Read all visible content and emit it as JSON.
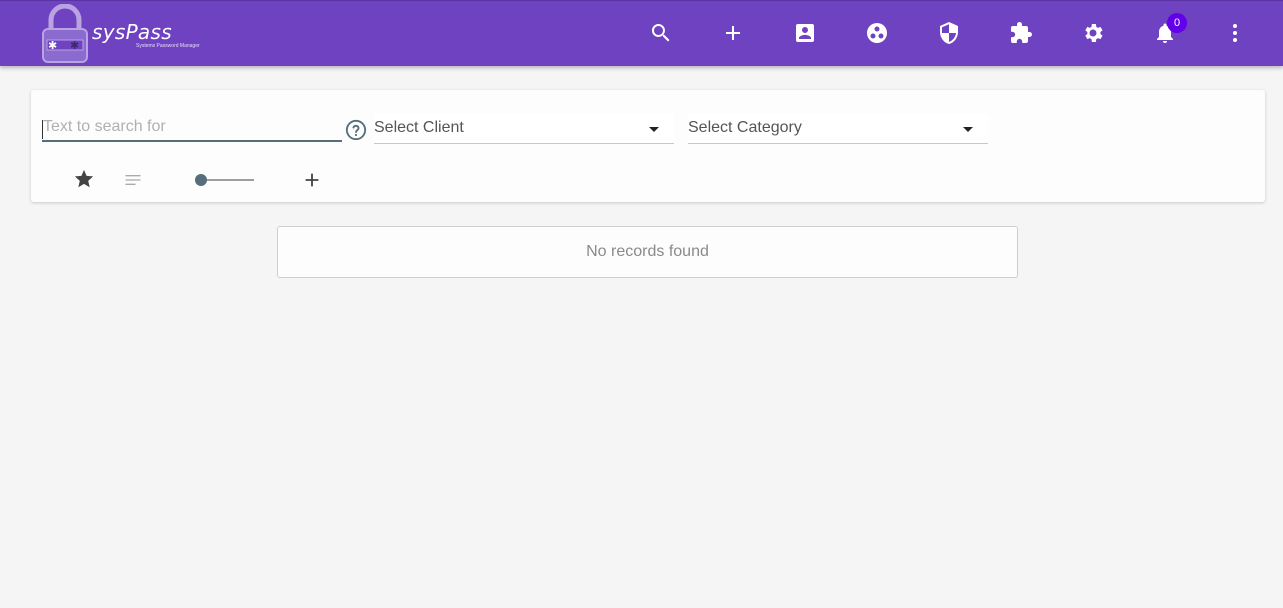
{
  "header": {
    "app_name": "sysPass",
    "app_subtitle": "Systems Password Manager",
    "nav_icons": [
      "search-icon",
      "add-icon",
      "account-box-icon",
      "group-icon",
      "security-shield-icon",
      "plugin-icon",
      "settings-icon",
      "notifications-icon",
      "more-vert-icon"
    ],
    "notifications_count": "0"
  },
  "search": {
    "placeholder": "Text to search for",
    "client_select": "Select Client",
    "category_select": "Select Category"
  },
  "tools": {
    "icons": [
      "favorite-star-icon",
      "sort-icon",
      "view-mode-slider",
      "add-icon"
    ]
  },
  "results": {
    "empty_message": "No records found"
  },
  "colors": {
    "topbar": "#6f42c1",
    "badge": "#6200ea",
    "accent": "#546e7a"
  }
}
